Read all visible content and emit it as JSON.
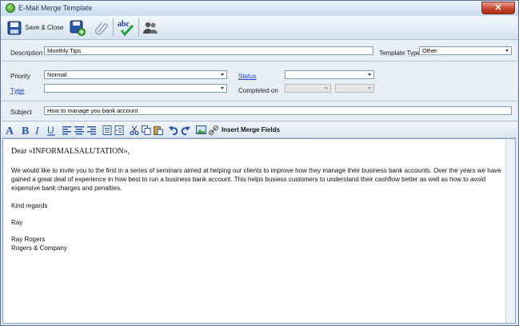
{
  "window": {
    "title": "E-Mail Merge Template",
    "close_glyph": "✕"
  },
  "toolbar": {
    "save_close_label": "Save & Close"
  },
  "form": {
    "description_label": "Description",
    "description_value": "Monthly Tips",
    "template_type_label": "Template Type",
    "template_type_value": "Other",
    "priority_label": "Priority",
    "priority_value": "Normal",
    "status_label": "Status",
    "status_value": "",
    "type_label": "Type",
    "type_value": "",
    "completed_on_label": "Completed on",
    "subject_label": "Subject",
    "subject_value": "How to manage you bank account"
  },
  "format_bar": {
    "insert_merge_fields_label": "Insert Merge Fields"
  },
  "editor": {
    "greeting": "Dear «INFORMALSALUTATION»,",
    "paragraph1": "We would like to invite you to the first in a series of seminars aimed at helping our clients to improve how they manage their business bank accounts. Over the years we have gained a great deal of experience in how best to run a business bank account. This helps busiess customers to understand their cashflow better as well as how to avoid expensive bank charges and penalties.",
    "closing": "Kind regards",
    "sender_first": "Ray",
    "sender_full": "Ray Rogers",
    "company": "Rogers & Company"
  }
}
